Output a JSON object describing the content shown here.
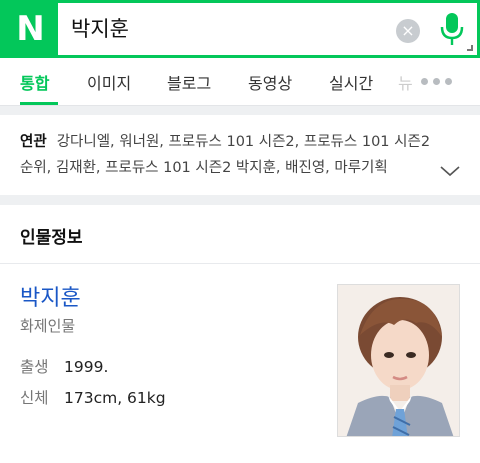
{
  "search": {
    "logo": "N",
    "query": "박지훈",
    "clear_icon": "×"
  },
  "tabs": [
    {
      "label": "통합"
    },
    {
      "label": "이미지"
    },
    {
      "label": "블로그"
    },
    {
      "label": "동영상"
    },
    {
      "label": "실시간"
    },
    {
      "label": "뉴"
    }
  ],
  "related": {
    "heading": "연관",
    "terms": "강다니엘, 워너원, 프로듀스 101 시즌2, 프로듀스 101 시즌2 순위, 김재환, 프로듀스 101 시즌2 박지훈, 배진영, 마루기획"
  },
  "profile": {
    "section_title": "인물정보",
    "name": "박지훈",
    "category": "화제인물",
    "birth_label": "출생",
    "birth_value": "1999.",
    "body_label": "신체",
    "body_value": "173cm, 61kg"
  },
  "colors": {
    "brand": "#03c75a",
    "link": "#1a57c6"
  }
}
